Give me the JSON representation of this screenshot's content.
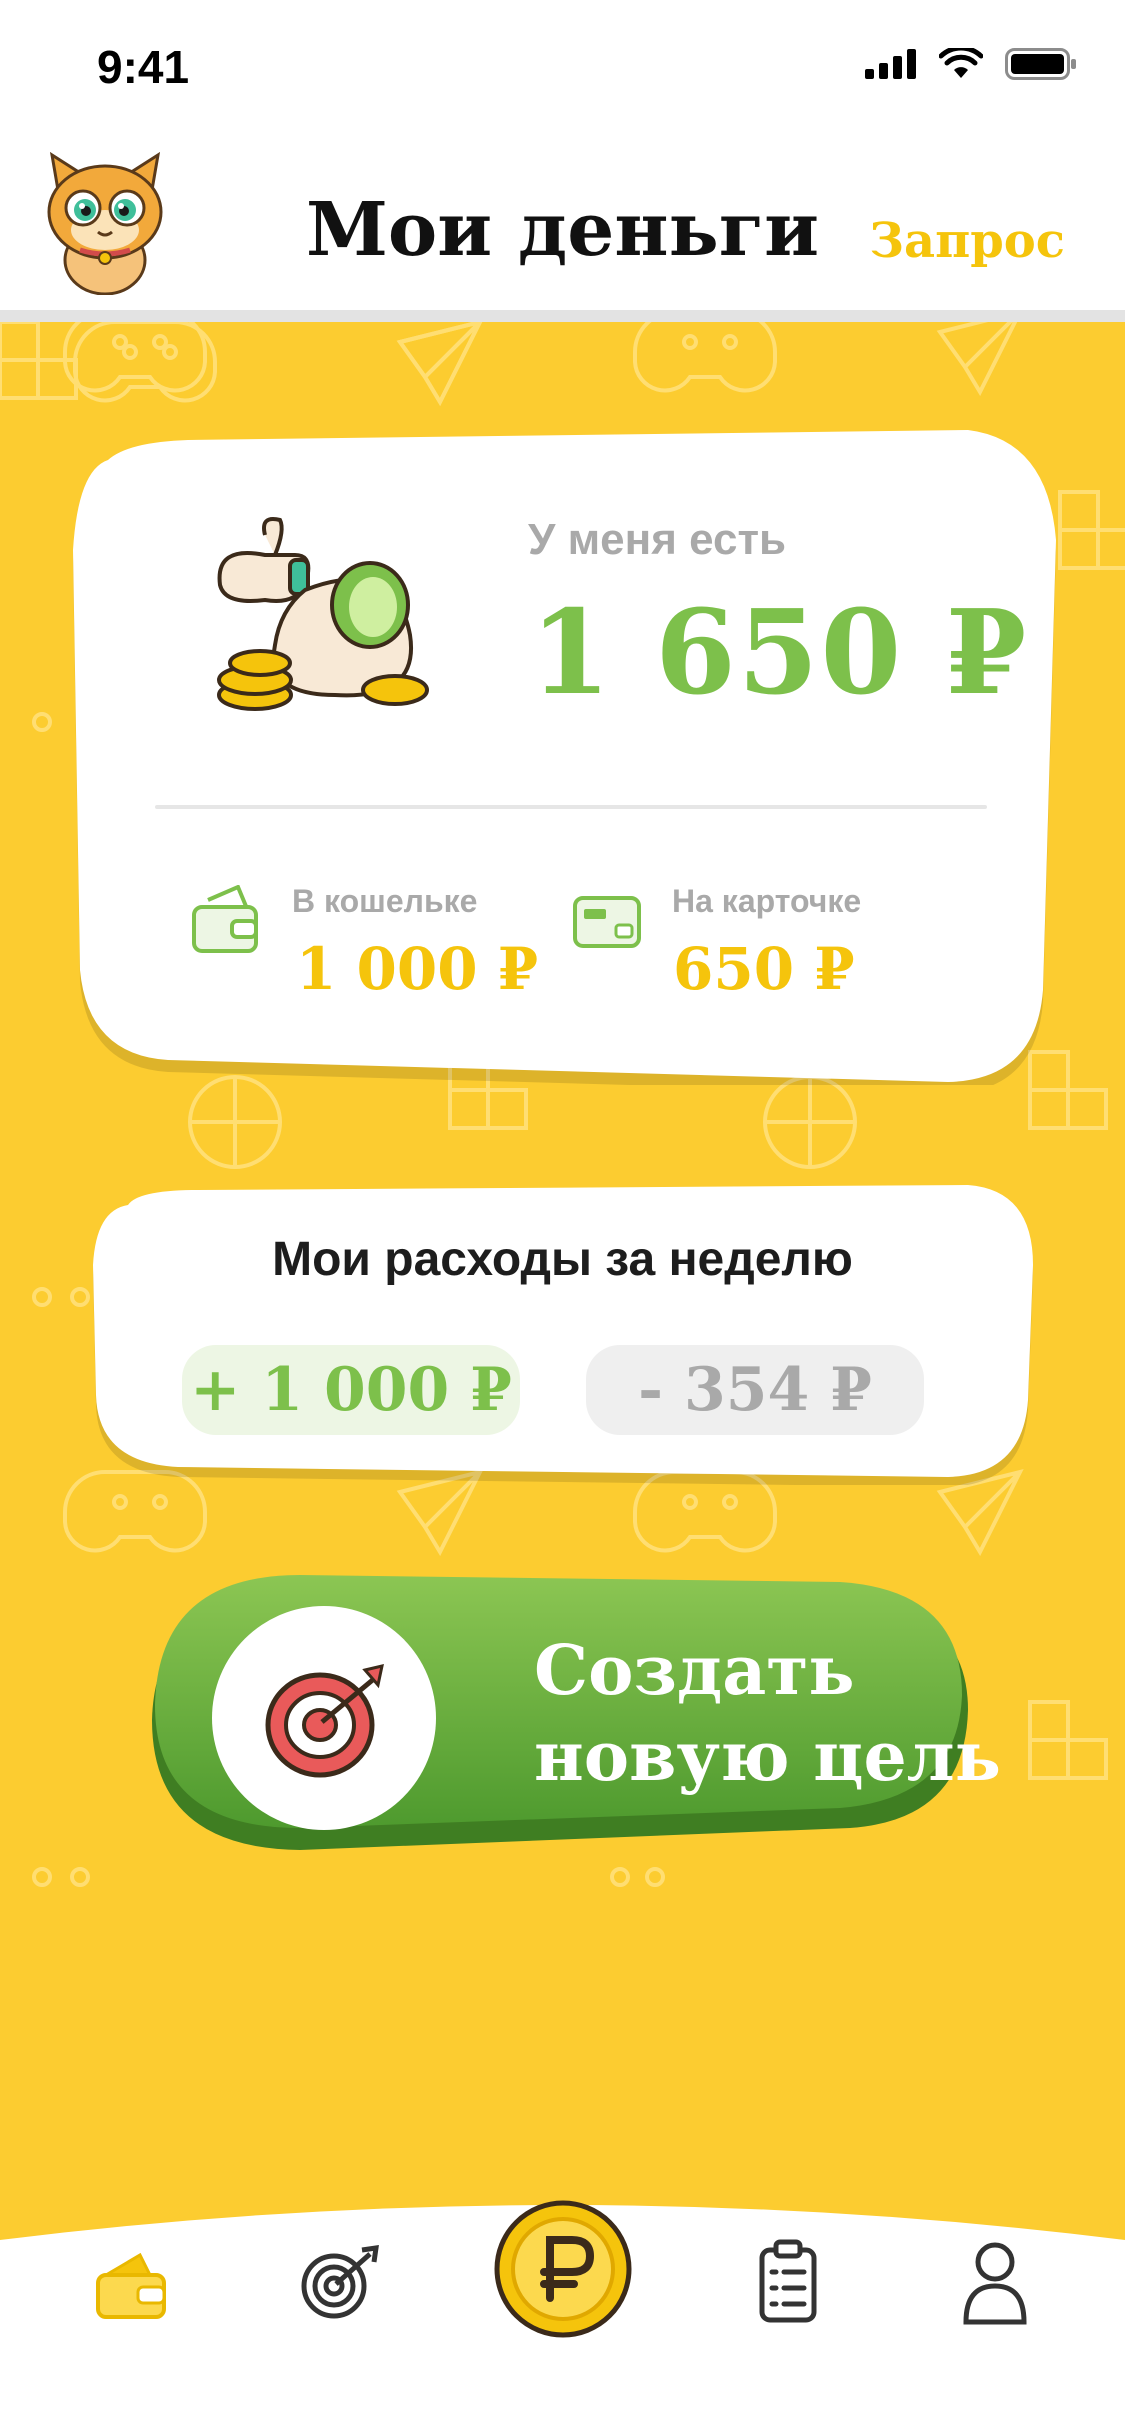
{
  "status_bar": {
    "time": "9:41"
  },
  "header": {
    "title": "Мои деньги",
    "request_label": "Запрос"
  },
  "balance": {
    "label": "У меня есть",
    "amount": "1 650 ₽",
    "wallet_label": "В кошельке",
    "wallet_amount": "1 000 ₽",
    "card_label": "На карточке",
    "card_amount": "650 ₽"
  },
  "weekly": {
    "title": "Мои расходы за неделю",
    "income": "+ 1 000 ₽",
    "expense": "- 354 ₽"
  },
  "goal_button": {
    "line1": "Создать",
    "line2": "новую цель"
  },
  "tabs": [
    {
      "icon": "wallet-icon",
      "active": true
    },
    {
      "icon": "target-icon",
      "active": false
    },
    {
      "icon": "coin-icon",
      "active": false
    },
    {
      "icon": "checklist-icon",
      "active": false
    },
    {
      "icon": "profile-icon",
      "active": false
    }
  ],
  "colors": {
    "background": "#FCCC30",
    "accent_yellow": "#F5C40C",
    "green": "#7DC04B",
    "button_green": "#5FA33A"
  }
}
